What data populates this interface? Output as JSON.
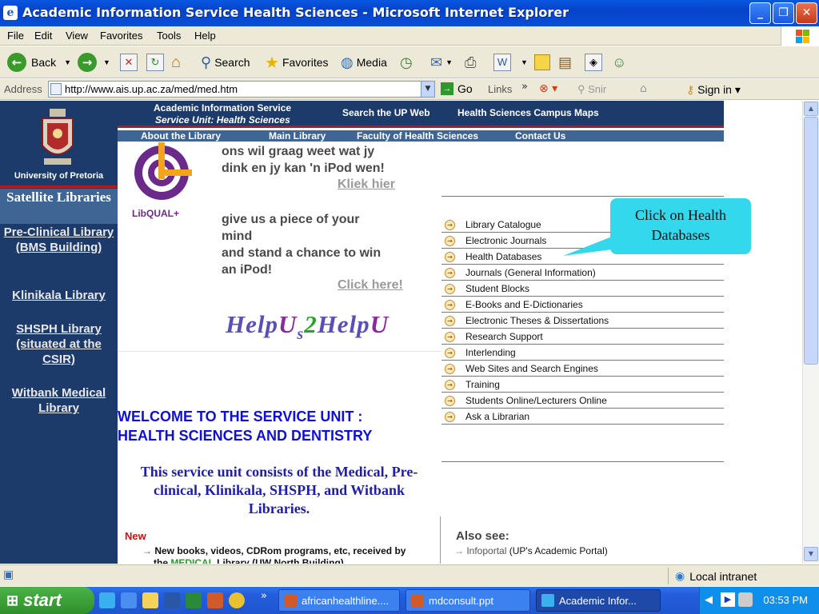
{
  "window": {
    "title": "Academic Information Service Health Sciences - Microsoft Internet Explorer"
  },
  "menu": [
    "File",
    "Edit",
    "View",
    "Favorites",
    "Tools",
    "Help"
  ],
  "toolbar": {
    "back": "Back",
    "search": "Search",
    "favorites": "Favorites",
    "media": "Media"
  },
  "address": {
    "label": "Address",
    "url": "http://www.ais.up.ac.za/med/med.htm",
    "go": "Go",
    "links": "Links",
    "snip": "Snir",
    "signin": "Sign in"
  },
  "page": {
    "sidebar": {
      "university": "University of Pretoria",
      "satellite_title": "Satellite Libraries",
      "libraries": [
        "Pre-Clinical Library (BMS Building)",
        "Klinikala Library",
        "SHSPH Library (situated at the CSIR)",
        "Witbank Medical Library"
      ]
    },
    "header": {
      "line1": "Academic Information Service",
      "line2": "Service Unit: Health Sciences",
      "search": "Search the UP Web",
      "maps": "Health Sciences Campus Maps"
    },
    "subnav": [
      "About the Library",
      "Main Library",
      "Faculty of Health Sciences",
      "Contact Us"
    ],
    "libqual": {
      "logo": "LibQUAL+",
      "afrikaans_l1": "ons wil graag weet wat jy",
      "afrikaans_l2": "dink en jy kan 'n iPod wen!",
      "afrikaans_link": "Kliek hier",
      "english_l1": "give us a piece of your",
      "english_l2": "mind",
      "english_l3": "and stand a chance to win",
      "english_l4": "an iPod!",
      "english_link": "Click here!"
    },
    "helpus": {
      "part1": "Help",
      "u1": "U",
      "s": "s",
      "two": "2",
      "part2": "Help",
      "u2": "U"
    },
    "welcome": {
      "l1": "WELCOME TO THE SERVICE UNIT :",
      "l2": "HEALTH SCIENCES AND DENTISTRY"
    },
    "service_unit_text": "This service unit consists of the Medical, Pre-clinical, Klinikala, SHSPH, and Witbank Libraries.",
    "new": {
      "label": "New",
      "text": "New books, videos, CDRom programs, etc, received by",
      "text2_pre": "the",
      "text2_link": "MEDICAL",
      "text2_post": "Library (UW North Building)"
    },
    "quicklinks": [
      "Library Catalogue",
      "Electronic Journals",
      "Health Databases",
      "Journals (General Information)",
      "Student Blocks",
      "E-Books and E-Dictionaries",
      "Electronic Theses & Dissertations",
      "Research Support",
      "Interlending",
      "Web Sites and Search Engines",
      "Training",
      "Students Online/Lecturers Online",
      "Ask a Librarian"
    ],
    "callout": "Click on Health Databases",
    "also_see": {
      "title": "Also see:",
      "link": "Infoportal",
      "desc": "(UP's Academic Portal)"
    }
  },
  "status": {
    "zone": "Local intranet"
  },
  "taskbar": {
    "start": "start",
    "tasks": [
      "africanhealthline....",
      "mdconsult.ppt",
      "Academic Infor..."
    ],
    "clock": "03:53 PM"
  },
  "colors": {
    "nav_dark": "#1c3a6a",
    "nav_mid": "#3e6594",
    "accent_red": "#b01c1c",
    "welcome_blue": "#0f0fd8",
    "callout": "#34d8ec"
  }
}
